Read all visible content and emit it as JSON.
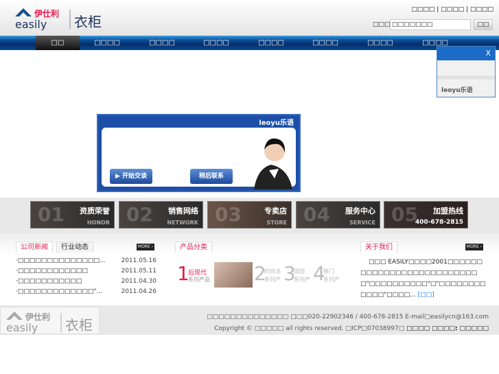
{
  "header": {
    "logo_cn": "伊仕利",
    "logo_en": "easily",
    "logo_product": "衣柜",
    "top_links": [
      "□□□□",
      "□□□□",
      "□□□□"
    ],
    "search_label": "□□□□□",
    "search_value": "□□□□□□□",
    "search_button": "□□"
  },
  "nav": {
    "items": [
      "□□",
      "□□□□",
      "□□□□",
      "□□□□",
      "□□□□",
      "□□□□",
      "□□□□",
      "□□□□"
    ]
  },
  "chat": {
    "brand": "leoyu乐语",
    "start_button": "开始交谈",
    "later_button": "稍后联系"
  },
  "float_widget": {
    "close": "X",
    "brand": "leoyu乐语"
  },
  "banners": [
    {
      "title": "资质荣誉",
      "sub": "HONOR",
      "num": "01"
    },
    {
      "title": "销售网络",
      "sub": "NETWORK",
      "num": "02"
    },
    {
      "title": "专卖店",
      "sub": "STORE",
      "num": "03"
    },
    {
      "title": "服务中心",
      "sub": "SERVICE",
      "num": "04"
    },
    {
      "title": "加盟热线",
      "sub": "400-678-2815",
      "num": "05"
    }
  ],
  "news": {
    "tabs": [
      "公司新闻",
      "行业动态"
    ],
    "more": "MORE ›",
    "items": [
      {
        "title": "·□□□□□□□□□□□□□□...",
        "date": "2011.05.16"
      },
      {
        "title": "·□□□□□□□□□□□□",
        "date": "2011.05.11"
      },
      {
        "title": "·□□□□□□□□□□□",
        "date": "2011.04.30"
      },
      {
        "title": "·□□□□□□□□□□□□□\"...",
        "date": "2011.04.26"
      }
    ]
  },
  "products": {
    "tab": "产品分类",
    "items": [
      {
        "num": "1",
        "name": "后现代",
        "sub": "系列产品"
      },
      {
        "num": "2",
        "name": "时尚派",
        "sub": "系列产"
      },
      {
        "num": "3",
        "name": "田园",
        "sub": "系列产"
      },
      {
        "num": "4",
        "name": "移门",
        "sub": "系列产"
      }
    ]
  },
  "about": {
    "tab": "关于我们",
    "more": "MORE ›",
    "text": "□□□ EASILY□□□□2001□□□□□□□□□□□□□□□□□□□□□□□□□□□\"□□□□□□□□□□\"□\"□□□□□□□□□□□□\"□□□□...",
    "link": "[□□]"
  },
  "footer": {
    "line1": "□□□□□□□□□□□□□□ □□□020-22902346 / 400-678-2815 E-mail□easilycn@163.com",
    "line2": "Copyright © □□□□□ all rights reserved. □ICP□07038997□",
    "links": [
      "□□□□",
      "□□□□:",
      "□□□□□"
    ]
  }
}
